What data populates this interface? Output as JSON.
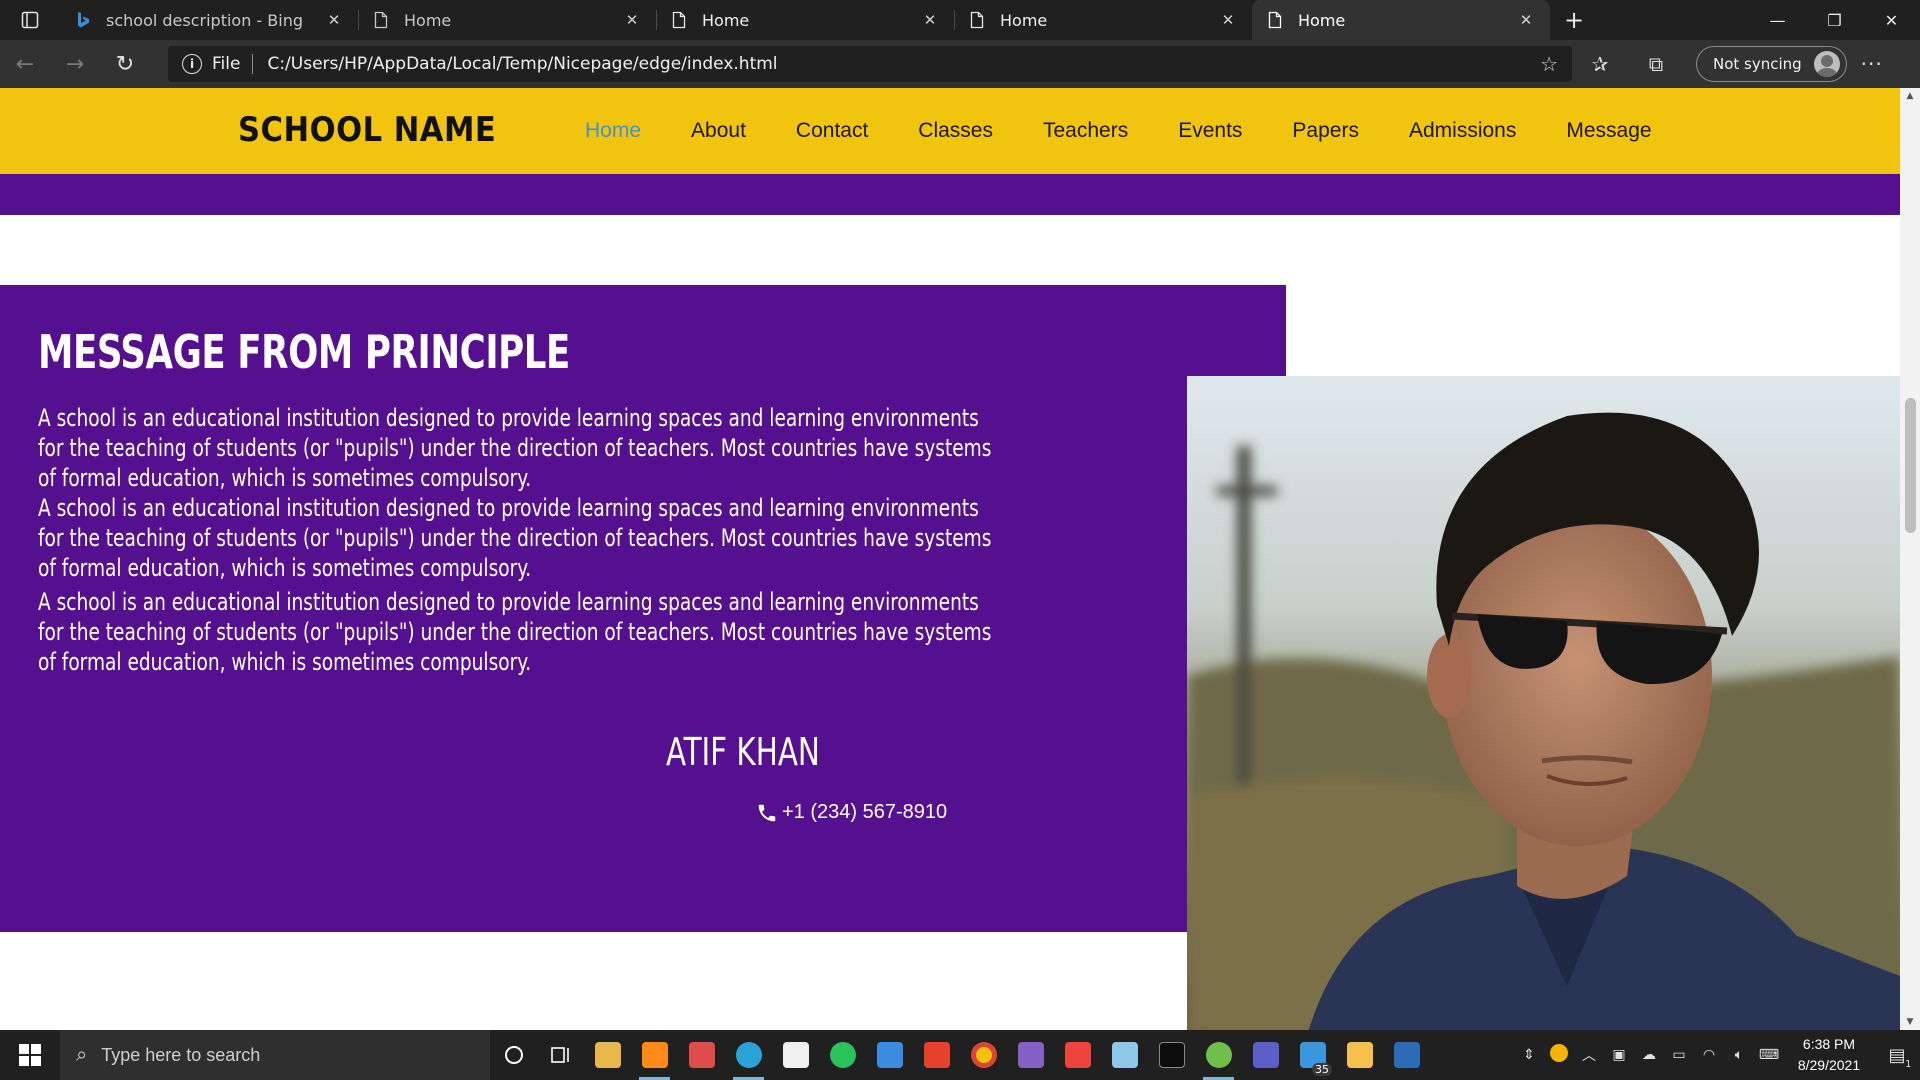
{
  "browser": {
    "tabs": [
      {
        "title": "school description - Bing",
        "icon": "bing-icon",
        "active": false
      },
      {
        "title": "Home",
        "icon": "page-icon",
        "active": false
      },
      {
        "title": "Home",
        "icon": "page-icon",
        "active": false
      },
      {
        "title": "Home",
        "icon": "page-icon",
        "active": false
      },
      {
        "title": "Home",
        "icon": "page-icon",
        "active": true
      }
    ],
    "address": {
      "scheme": "File",
      "url": "C:/Users/HP/AppData/Local/Temp/Nicepage/edge/index.html"
    },
    "sync_label": "Not syncing"
  },
  "site": {
    "logo": "SCHOOL NAME",
    "menu": [
      "Home",
      "About",
      "Contact",
      "Classes",
      "Teachers",
      "Events",
      "Papers",
      "Admissions",
      "Message"
    ],
    "active_menu": "Home",
    "colors": {
      "header": "#f1c40f",
      "purple": "#55108f",
      "active_link": "#4a90c8"
    }
  },
  "message": {
    "title": "MESSAGE FROM PRINCIPLE",
    "paragraphs": [
      "A school is an educational institution designed to provide learning spaces and learning environments for the teaching of students (or \"pupils\") under the direction of teachers. Most countries have systems of formal education, which is sometimes compulsory.",
      "A school is an educational institution designed to provide learning spaces and learning environments for the teaching of students (or \"pupils\") under the direction of teachers. Most countries have systems of formal education, which is sometimes compulsory.",
      "A school is an educational institution designed to provide learning spaces and learning environments for the teaching of students (or \"pupils\") under the direction of teachers. Most countries have systems of formal education, which is sometimes compulsory."
    ],
    "name": "ATIF KHAN",
    "phone": "+1 (234) 567-8910"
  },
  "taskbar": {
    "search_placeholder": "Type here to search",
    "time": "6:38 PM",
    "date": "8/29/2021",
    "mail_badge": "35",
    "notification_count": "1"
  }
}
